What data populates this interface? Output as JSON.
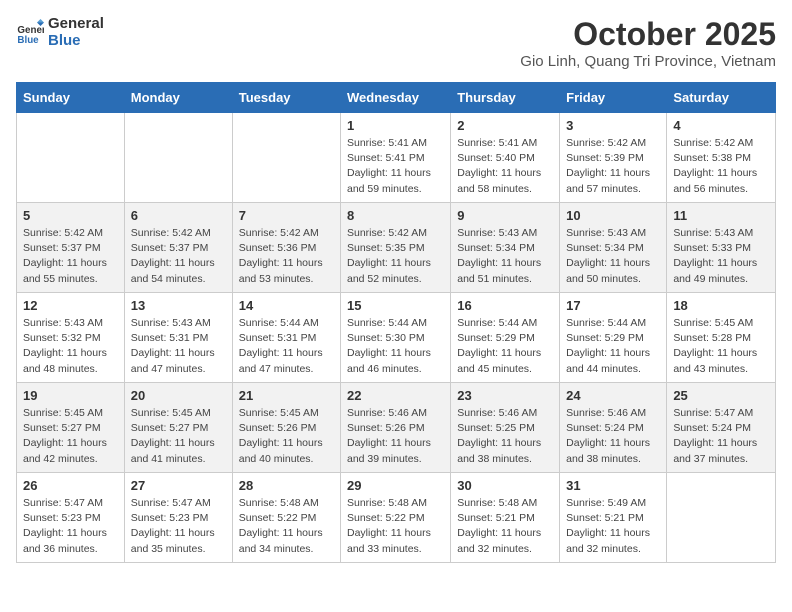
{
  "logo": {
    "text_general": "General",
    "text_blue": "Blue"
  },
  "header": {
    "month_title": "October 2025",
    "location": "Gio Linh, Quang Tri Province, Vietnam"
  },
  "weekdays": [
    "Sunday",
    "Monday",
    "Tuesday",
    "Wednesday",
    "Thursday",
    "Friday",
    "Saturday"
  ],
  "weeks": [
    [
      {
        "day": "",
        "info": ""
      },
      {
        "day": "",
        "info": ""
      },
      {
        "day": "",
        "info": ""
      },
      {
        "day": "1",
        "info": "Sunrise: 5:41 AM\nSunset: 5:41 PM\nDaylight: 11 hours\nand 59 minutes."
      },
      {
        "day": "2",
        "info": "Sunrise: 5:41 AM\nSunset: 5:40 PM\nDaylight: 11 hours\nand 58 minutes."
      },
      {
        "day": "3",
        "info": "Sunrise: 5:42 AM\nSunset: 5:39 PM\nDaylight: 11 hours\nand 57 minutes."
      },
      {
        "day": "4",
        "info": "Sunrise: 5:42 AM\nSunset: 5:38 PM\nDaylight: 11 hours\nand 56 minutes."
      }
    ],
    [
      {
        "day": "5",
        "info": "Sunrise: 5:42 AM\nSunset: 5:37 PM\nDaylight: 11 hours\nand 55 minutes."
      },
      {
        "day": "6",
        "info": "Sunrise: 5:42 AM\nSunset: 5:37 PM\nDaylight: 11 hours\nand 54 minutes."
      },
      {
        "day": "7",
        "info": "Sunrise: 5:42 AM\nSunset: 5:36 PM\nDaylight: 11 hours\nand 53 minutes."
      },
      {
        "day": "8",
        "info": "Sunrise: 5:42 AM\nSunset: 5:35 PM\nDaylight: 11 hours\nand 52 minutes."
      },
      {
        "day": "9",
        "info": "Sunrise: 5:43 AM\nSunset: 5:34 PM\nDaylight: 11 hours\nand 51 minutes."
      },
      {
        "day": "10",
        "info": "Sunrise: 5:43 AM\nSunset: 5:34 PM\nDaylight: 11 hours\nand 50 minutes."
      },
      {
        "day": "11",
        "info": "Sunrise: 5:43 AM\nSunset: 5:33 PM\nDaylight: 11 hours\nand 49 minutes."
      }
    ],
    [
      {
        "day": "12",
        "info": "Sunrise: 5:43 AM\nSunset: 5:32 PM\nDaylight: 11 hours\nand 48 minutes."
      },
      {
        "day": "13",
        "info": "Sunrise: 5:43 AM\nSunset: 5:31 PM\nDaylight: 11 hours\nand 47 minutes."
      },
      {
        "day": "14",
        "info": "Sunrise: 5:44 AM\nSunset: 5:31 PM\nDaylight: 11 hours\nand 47 minutes."
      },
      {
        "day": "15",
        "info": "Sunrise: 5:44 AM\nSunset: 5:30 PM\nDaylight: 11 hours\nand 46 minutes."
      },
      {
        "day": "16",
        "info": "Sunrise: 5:44 AM\nSunset: 5:29 PM\nDaylight: 11 hours\nand 45 minutes."
      },
      {
        "day": "17",
        "info": "Sunrise: 5:44 AM\nSunset: 5:29 PM\nDaylight: 11 hours\nand 44 minutes."
      },
      {
        "day": "18",
        "info": "Sunrise: 5:45 AM\nSunset: 5:28 PM\nDaylight: 11 hours\nand 43 minutes."
      }
    ],
    [
      {
        "day": "19",
        "info": "Sunrise: 5:45 AM\nSunset: 5:27 PM\nDaylight: 11 hours\nand 42 minutes."
      },
      {
        "day": "20",
        "info": "Sunrise: 5:45 AM\nSunset: 5:27 PM\nDaylight: 11 hours\nand 41 minutes."
      },
      {
        "day": "21",
        "info": "Sunrise: 5:45 AM\nSunset: 5:26 PM\nDaylight: 11 hours\nand 40 minutes."
      },
      {
        "day": "22",
        "info": "Sunrise: 5:46 AM\nSunset: 5:26 PM\nDaylight: 11 hours\nand 39 minutes."
      },
      {
        "day": "23",
        "info": "Sunrise: 5:46 AM\nSunset: 5:25 PM\nDaylight: 11 hours\nand 38 minutes."
      },
      {
        "day": "24",
        "info": "Sunrise: 5:46 AM\nSunset: 5:24 PM\nDaylight: 11 hours\nand 38 minutes."
      },
      {
        "day": "25",
        "info": "Sunrise: 5:47 AM\nSunset: 5:24 PM\nDaylight: 11 hours\nand 37 minutes."
      }
    ],
    [
      {
        "day": "26",
        "info": "Sunrise: 5:47 AM\nSunset: 5:23 PM\nDaylight: 11 hours\nand 36 minutes."
      },
      {
        "day": "27",
        "info": "Sunrise: 5:47 AM\nSunset: 5:23 PM\nDaylight: 11 hours\nand 35 minutes."
      },
      {
        "day": "28",
        "info": "Sunrise: 5:48 AM\nSunset: 5:22 PM\nDaylight: 11 hours\nand 34 minutes."
      },
      {
        "day": "29",
        "info": "Sunrise: 5:48 AM\nSunset: 5:22 PM\nDaylight: 11 hours\nand 33 minutes."
      },
      {
        "day": "30",
        "info": "Sunrise: 5:48 AM\nSunset: 5:21 PM\nDaylight: 11 hours\nand 32 minutes."
      },
      {
        "day": "31",
        "info": "Sunrise: 5:49 AM\nSunset: 5:21 PM\nDaylight: 11 hours\nand 32 minutes."
      },
      {
        "day": "",
        "info": ""
      }
    ]
  ]
}
